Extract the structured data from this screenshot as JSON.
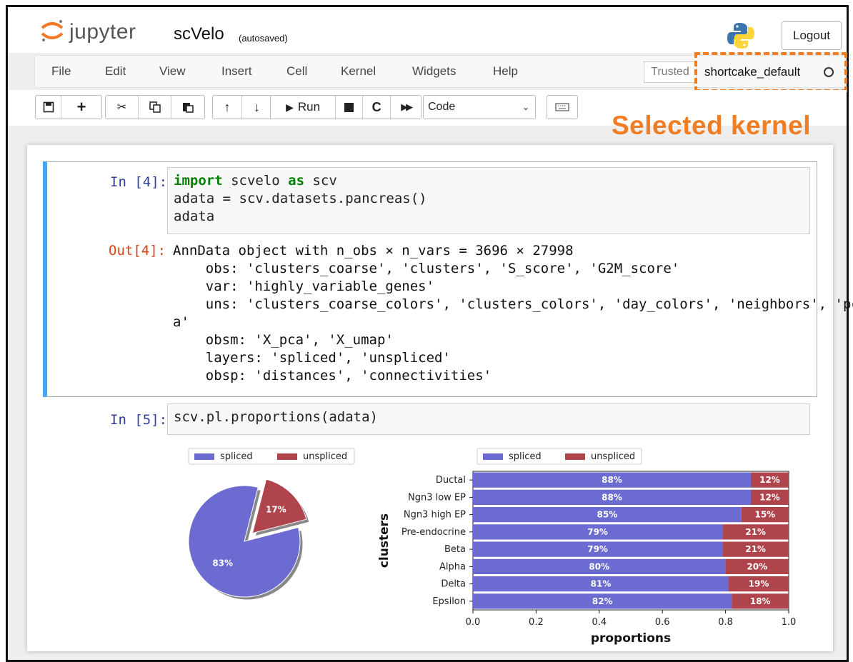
{
  "app": {
    "name": "jupyter",
    "notebook_title": "scVelo",
    "autosave": "(autosaved)",
    "logout_label": "Logout"
  },
  "menu": [
    "File",
    "Edit",
    "View",
    "Insert",
    "Cell",
    "Kernel",
    "Widgets",
    "Help"
  ],
  "trusted_label": "Trusted",
  "kernel": {
    "name": "shortcake_default",
    "annotation": "Selected kernel"
  },
  "toolbar": {
    "icons": [
      "save-icon",
      "plus-icon",
      "cut-icon",
      "copy-icon",
      "paste-icon",
      "arrow-up-icon",
      "arrow-down-icon",
      "play-icon",
      "stop-icon",
      "restart-icon",
      "fast-forward-icon",
      "keyboard-icon"
    ],
    "run_label": "Run",
    "cell_type": "Code"
  },
  "colors": {
    "accent": "#f07d21",
    "selected_cell": "#42a5f5",
    "spliced": "#6b6bd1",
    "unspliced": "#b0444c"
  },
  "cells": [
    {
      "in_prompt": "In [4]:",
      "code_lines": [
        "import scvelo as scv",
        "adata = scv.datasets.pancreas()",
        "adata"
      ],
      "out_prompt": "Out[4]:",
      "output_lines": [
        "AnnData object with n_obs × n_vars = 3696 × 27998",
        "    obs: 'clusters_coarse', 'clusters', 'S_score', 'G2M_score'",
        "    var: 'highly_variable_genes'",
        "    uns: 'clusters_coarse_colors', 'clusters_colors', 'day_colors', 'neighbors', 'pc",
        "a'",
        "    obsm: 'X_pca', 'X_umap'",
        "    layers: 'spliced', 'unspliced'",
        "    obsp: 'distances', 'connectivities'"
      ]
    },
    {
      "in_prompt": "In [5]:",
      "code_lines": [
        "scv.pl.proportions(adata)"
      ]
    }
  ],
  "chart_data": [
    {
      "type": "pie",
      "legend": [
        "spliced",
        "unspliced"
      ],
      "labels": [
        "spliced",
        "unspliced"
      ],
      "values": [
        83,
        17
      ],
      "value_labels": [
        "83%",
        "17%"
      ]
    },
    {
      "type": "bar",
      "orientation": "horizontal-stacked",
      "legend": [
        "spliced",
        "unspliced"
      ],
      "categories": [
        "Ductal",
        "Ngn3 low EP",
        "Ngn3 high EP",
        "Pre-endocrine",
        "Beta",
        "Alpha",
        "Delta",
        "Epsilon"
      ],
      "series": [
        {
          "name": "spliced",
          "values": [
            0.88,
            0.88,
            0.85,
            0.79,
            0.79,
            0.8,
            0.81,
            0.82
          ],
          "labels": [
            "88%",
            "88%",
            "85%",
            "79%",
            "79%",
            "80%",
            "81%",
            "82%"
          ]
        },
        {
          "name": "unspliced",
          "values": [
            0.12,
            0.12,
            0.15,
            0.21,
            0.21,
            0.2,
            0.19,
            0.18
          ],
          "labels": [
            "12%",
            "12%",
            "15%",
            "21%",
            "21%",
            "20%",
            "19%",
            "18%"
          ]
        }
      ],
      "xlabel": "proportions",
      "ylabel": "clusters",
      "xticks": [
        "0.0",
        "0.2",
        "0.4",
        "0.6",
        "0.8",
        "1.0"
      ],
      "xlim": [
        0,
        1
      ]
    }
  ]
}
